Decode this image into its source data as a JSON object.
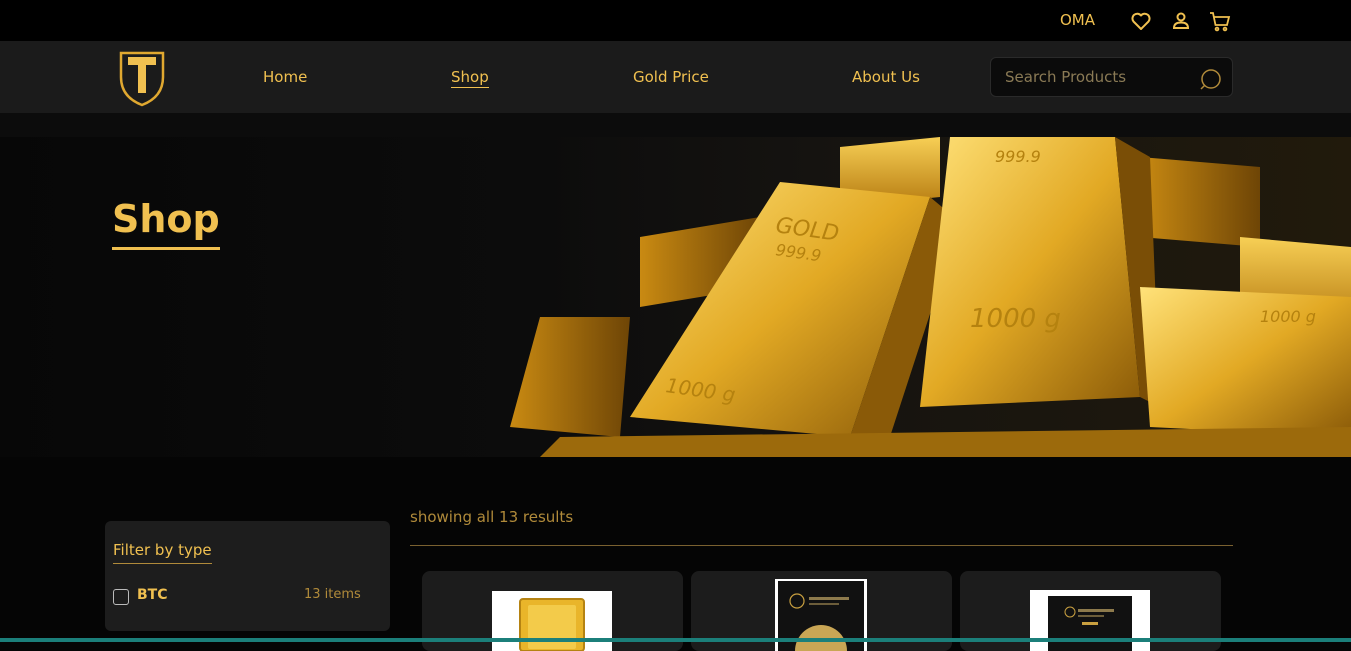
{
  "topbar": {
    "currency": "OMA",
    "icons": [
      "heart-icon",
      "user-icon",
      "cart-icon"
    ]
  },
  "nav": {
    "links": [
      {
        "label": "Home",
        "active": false
      },
      {
        "label": "Shop",
        "active": true
      },
      {
        "label": "Gold Price",
        "active": false
      },
      {
        "label": "About Us",
        "active": false
      }
    ],
    "search_placeholder": "Search Products"
  },
  "hero": {
    "title": "Shop",
    "image_text": [
      "GOLD",
      "999.9",
      "1000 g",
      "999.9",
      "1000 g",
      "1000 g"
    ]
  },
  "filter": {
    "title": "Filter by type",
    "options": [
      {
        "label": "BTC",
        "count": "13 items",
        "checked": false
      }
    ]
  },
  "results": {
    "summary": "showing all 13 results"
  },
  "colors": {
    "accent": "#f0c050",
    "background": "#050505",
    "panel": "#1c1c1c"
  }
}
